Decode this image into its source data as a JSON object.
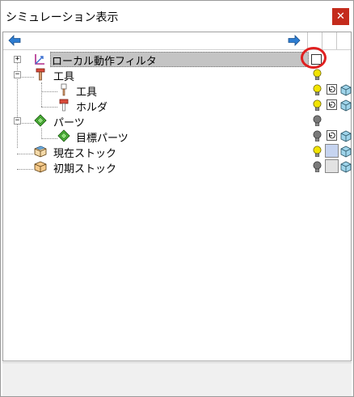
{
  "window": {
    "title": "シミュレーション表示",
    "close_glyph": "✕"
  },
  "toolbar": {
    "back_icon": "arrow-left-icon",
    "forward_icon": "arrow-right-icon"
  },
  "tree": {
    "nodes": [
      {
        "label": "ローカル動作フィルタ",
        "icon": "local-filter-icon",
        "expander": "+",
        "selected": true,
        "control": "checkbox",
        "checked": false
      },
      {
        "label": "工具",
        "icon": "tool-icon",
        "expander": "−",
        "bulb": "yellow"
      },
      {
        "label": "工具",
        "icon": "tool-small-icon",
        "bulb": "yellow",
        "has_reset_button": true,
        "has_cube": true
      },
      {
        "label": "ホルダ",
        "icon": "holder-icon",
        "bulb": "yellow",
        "has_reset_button": true,
        "has_cube": true
      },
      {
        "label": "パーツ",
        "icon": "parts-icon",
        "expander": "−",
        "bulb": "gray"
      },
      {
        "label": "目標パーツ",
        "icon": "target-part-icon",
        "bulb": "gray",
        "has_reset_button": true,
        "has_cube": true
      },
      {
        "label": "現在ストック",
        "icon": "current-stock-icon",
        "bulb": "yellow",
        "stock_color": "#c6d4f0",
        "has_cube": true
      },
      {
        "label": "初期ストック",
        "icon": "initial-stock-icon",
        "bulb": "gray",
        "stock_color": "#e2e2e2",
        "has_cube": true
      }
    ]
  },
  "colors": {
    "bulb_yellow": "#f2e400",
    "bulb_gray": "#7a7a7a",
    "close_red": "#c42b1c",
    "highlight_circle": "#e02020",
    "arrow_blue": "#2d7dd2"
  }
}
